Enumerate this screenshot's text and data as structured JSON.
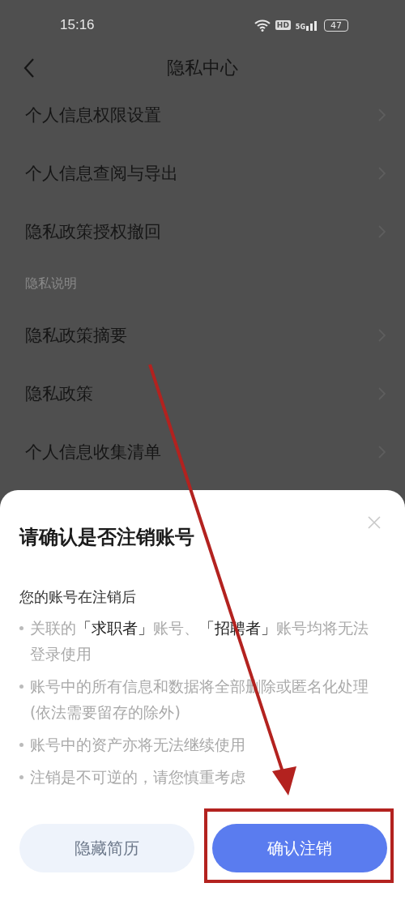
{
  "status_bar": {
    "time": "15:16",
    "hd": "HD",
    "network": "5G",
    "battery": "47"
  },
  "nav": {
    "title": "隐私中心"
  },
  "sections": [
    {
      "items": [
        "个人信息权限设置",
        "个人信息查阅与导出",
        "隐私政策授权撤回"
      ]
    },
    {
      "header": "隐私说明",
      "items": [
        "隐私政策摘要",
        "隐私政策",
        "个人信息收集清单"
      ]
    }
  ],
  "sheet": {
    "title": "请确认是否注销账号",
    "intro": "您的账号在注销后",
    "bullets": [
      "关联的**「求职者」**账号、**「招聘者」**账号均将无法登录使用",
      "账号中的所有信息和数据将全部删除或匿名化处理(依法需要留存的除外)",
      "账号中的资产亦将无法继续使用",
      "注销是不可逆的，请您慎重考虑"
    ],
    "buttons": [
      {
        "label": "隐藏简历",
        "kind": "secondary"
      },
      {
        "label": "确认注销",
        "kind": "primary"
      }
    ]
  },
  "annotations": {
    "arrow": true,
    "highlight_frame": true
  }
}
